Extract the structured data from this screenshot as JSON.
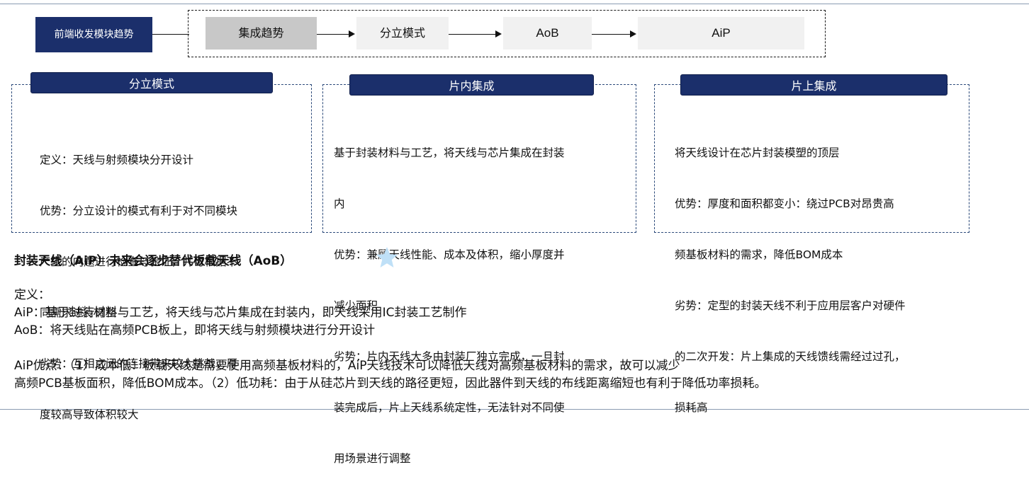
{
  "flow": {
    "start_label": "前端收发模块趋势",
    "steps": [
      "集成趋势",
      "分立模式",
      "AoB",
      "AiP"
    ]
  },
  "panels": [
    {
      "title": "分立模式",
      "lines": [
        "定义：天线与射频模块分开设计",
        "优势：分立设计的模式有利于对不同模块",
        "产生的向题进行检查与验证，并可根据不",
        "同需求进行调整",
        "劣势：互相之间的连接带来较大挑战，厚",
        "度较高导致体积较大"
      ]
    },
    {
      "title": "片内集成",
      "lines": [
        "基于封装材料与工艺，将天线与芯片集成在封装",
        "内",
        "优势：兼顾天线性能、成本及体积，缩小厚度并",
        "减少面积",
        "劣势：片内天线大多由封装厂独立完成，一旦封",
        "装完成后，片上天线系统定性，无法针对不同使",
        "用场景进行调整"
      ]
    },
    {
      "title": "片上集成",
      "lines": [
        "将天线设计在芯片封装模塑的顶层",
        "优势：厚度和面积都变小：绕过PCB对昂贵高",
        "频基板材料的需求，降低BOM成本",
        "劣势：定型的封装天线不利于应用层客户对硬件",
        "的二次开发：片上集成的天线馈线需经过过孔，",
        "损耗高"
      ]
    }
  ],
  "heading": "封装天线（AiP）未来会逐步替代板载天线（AoB）",
  "heading_icon": "star-icon",
  "colors": {
    "navy": "#1b2f6b",
    "star": "#bfe0f7",
    "grey_box": "#c8c8c8",
    "light_box": "#f1f1f1"
  },
  "body": {
    "lines": [
      "定义：",
      "AiP：基于封装材料与工艺，将天线与芯片集成在封装内，即天线采用IC封装工艺制作",
      "AoB：将天线贴在高频PCB板上，即将天线与射频模块进行分开设计",
      "",
      "AiP优点：（1）成本低：板载天线是需要使用高频基板材料的，AiP天线技术可以降低天线对高频基板材料的需求，故可以减少",
      "高频PCB基板面积，降低BOM成本。（2）低功耗：由于从硅芯片到天线的路径更短，因此器件到天线的布线距离缩短也有利于降低功率损耗。"
    ]
  }
}
